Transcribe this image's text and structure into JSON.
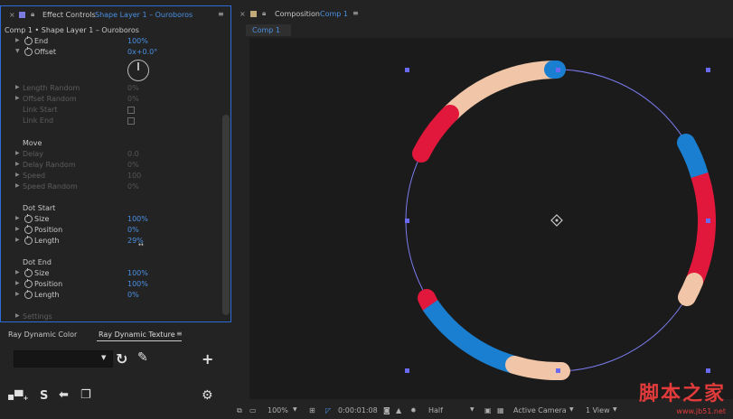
{
  "effect_controls": {
    "tab_label": "Effect Controls",
    "layer_label": "Shape Layer 1 – Ouroboros",
    "breadcrumb": "Comp 1 • Shape Layer 1 – Ouroboros",
    "rows": {
      "end": {
        "label": "End",
        "value": "100%"
      },
      "offset": {
        "label": "Offset",
        "value": "0x+0.0°"
      },
      "length_random": {
        "label": "Length Random",
        "value": "0%"
      },
      "offset_random": {
        "label": "Offset Random",
        "value": "0%"
      },
      "link_start": {
        "label": "Link Start"
      },
      "link_end": {
        "label": "Link End"
      },
      "move_title": "Move",
      "delay": {
        "label": "Delay",
        "value": "0.0"
      },
      "delay_random": {
        "label": "Delay Random",
        "value": "0%"
      },
      "speed": {
        "label": "Speed",
        "value": "100"
      },
      "speed_random": {
        "label": "Speed Random",
        "value": "0%"
      },
      "dot_start_title": "Dot Start",
      "ds_size": {
        "label": "Size",
        "value": "100%"
      },
      "ds_position": {
        "label": "Position",
        "value": "0%"
      },
      "ds_length": {
        "label": "Length",
        "value": "29%"
      },
      "dot_end_title": "Dot End",
      "de_size": {
        "label": "Size",
        "value": "100%"
      },
      "de_position": {
        "label": "Position",
        "value": "100%"
      },
      "de_length": {
        "label": "Length",
        "value": "0%"
      },
      "settings": {
        "label": "Settings"
      }
    }
  },
  "ray_panel": {
    "tab_color": "Ray Dynamic Color",
    "tab_texture": "Ray Dynamic Texture",
    "select_value": "",
    "icons": [
      "dropdown-arrow-icon",
      "refresh-icon",
      "pencil-icon",
      "plus-icon",
      "squares-add-icon",
      "s-icon",
      "arrow-back-icon",
      "copy-icon",
      "gear-icon"
    ]
  },
  "composition": {
    "tab_label": "Composition",
    "comp_name": "Comp 1",
    "viewer_tab": "Comp 1"
  },
  "footer": {
    "zoom": "100%",
    "timecode": "0:00:01:08",
    "resolution": "Half",
    "camera": "Active Camera",
    "views": "1 View"
  },
  "watermark": {
    "text": "脚本之家",
    "url": "www.jb51.net"
  },
  "colors": {
    "accent_blue": "#1a7fd0",
    "accent_red": "#e1173b",
    "peach": "#f0c5a8",
    "selection_blue": "#2d6bd8",
    "path_purple": "#7b7bf0"
  }
}
